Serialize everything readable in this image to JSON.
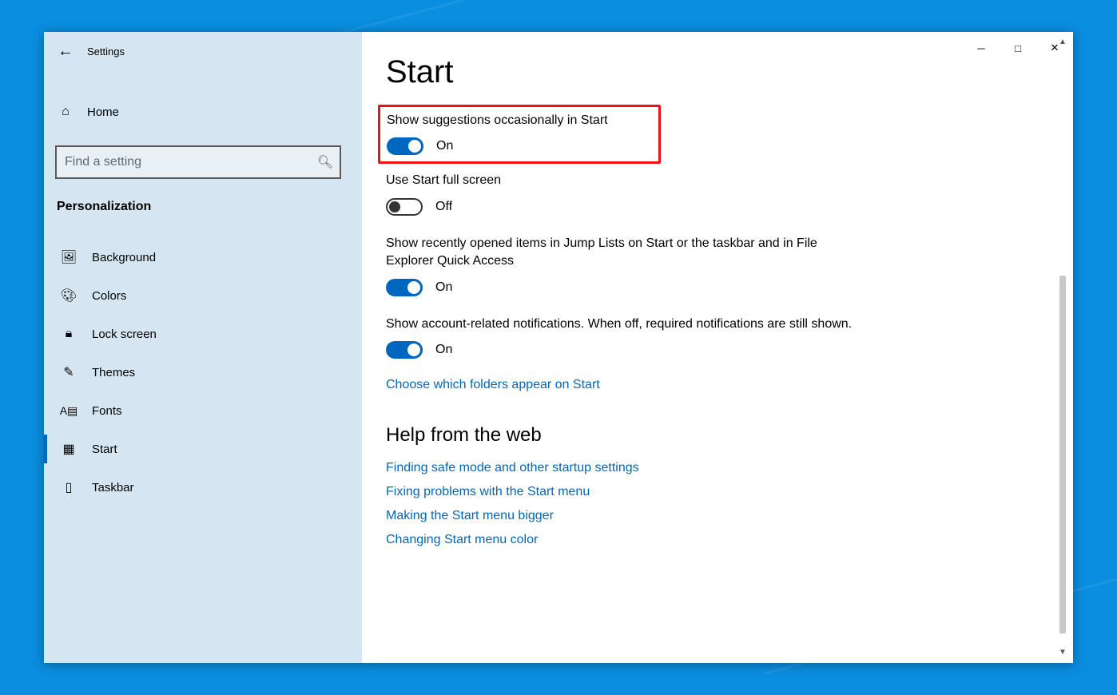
{
  "app": {
    "name": "Settings"
  },
  "sidebar": {
    "home": "Home",
    "search_placeholder": "Find a setting",
    "category": "Personalization",
    "items": [
      {
        "label": "Background",
        "icon": "image-icon"
      },
      {
        "label": "Colors",
        "icon": "palette-icon"
      },
      {
        "label": "Lock screen",
        "icon": "lock-screen-icon"
      },
      {
        "label": "Themes",
        "icon": "themes-icon"
      },
      {
        "label": "Fonts",
        "icon": "fonts-icon"
      },
      {
        "label": "Start",
        "icon": "start-icon"
      },
      {
        "label": "Taskbar",
        "icon": "taskbar-icon"
      }
    ],
    "selected_index": 5
  },
  "page": {
    "title": "Start",
    "settings": [
      {
        "label": "Show suggestions occasionally in Start",
        "on": true,
        "state": "On",
        "highlighted": true
      },
      {
        "label": "Use Start full screen",
        "on": false,
        "state": "Off",
        "highlighted": false
      },
      {
        "label": "Show recently opened items in Jump Lists on Start or the taskbar and in File Explorer Quick Access",
        "on": true,
        "state": "On",
        "highlighted": false
      },
      {
        "label": "Show account-related notifications. When off, required notifications are still shown.",
        "on": true,
        "state": "On",
        "highlighted": false
      }
    ],
    "folders_link": "Choose which folders appear on Start",
    "help_heading": "Help from the web",
    "help_links": [
      "Finding safe mode and other startup settings",
      "Fixing problems with the Start menu",
      "Making the Start menu bigger",
      "Changing Start menu color"
    ]
  }
}
